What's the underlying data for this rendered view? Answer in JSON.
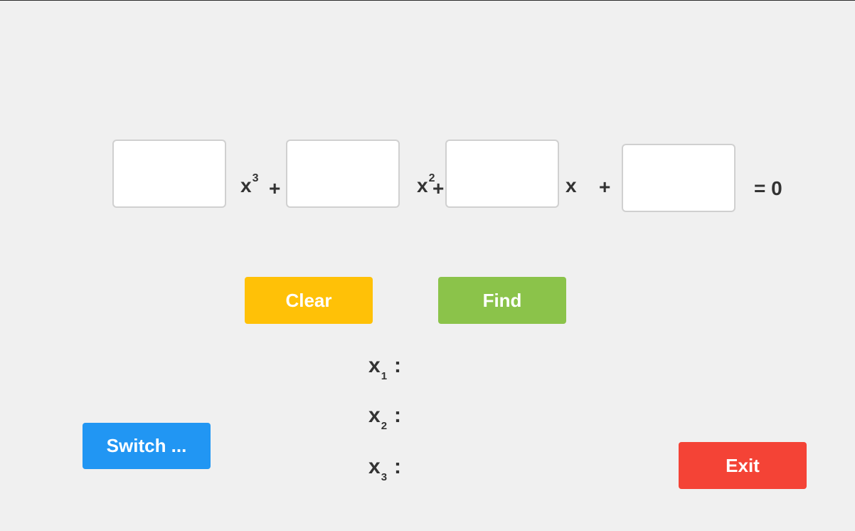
{
  "equation": {
    "a": {
      "value": "",
      "placeholder": ""
    },
    "b": {
      "value": "",
      "placeholder": ""
    },
    "c": {
      "value": "",
      "placeholder": ""
    },
    "d": {
      "value": "",
      "placeholder": ""
    },
    "x3_var": "x",
    "x3_exp": "3",
    "plus1": "+",
    "x2_var": "x",
    "x2_exp": "2",
    "plus2": "+",
    "x1_var": "x",
    "plus3": "+",
    "equals_zero": "= 0"
  },
  "buttons": {
    "clear": "Clear",
    "find": "Find",
    "switch": "Switch ...",
    "exit": "Exit"
  },
  "roots": [
    {
      "var": "x",
      "index": "1",
      "colon": ":",
      "value": ""
    },
    {
      "var": "x",
      "index": "2",
      "colon": ":",
      "value": ""
    },
    {
      "var": "x",
      "index": "3",
      "colon": ":",
      "value": ""
    }
  ],
  "colors": {
    "background": "#f0f0f0",
    "clear": "#ffc107",
    "find": "#8bc34a",
    "switch": "#2196f3",
    "exit": "#f44336",
    "text": "#333333"
  }
}
